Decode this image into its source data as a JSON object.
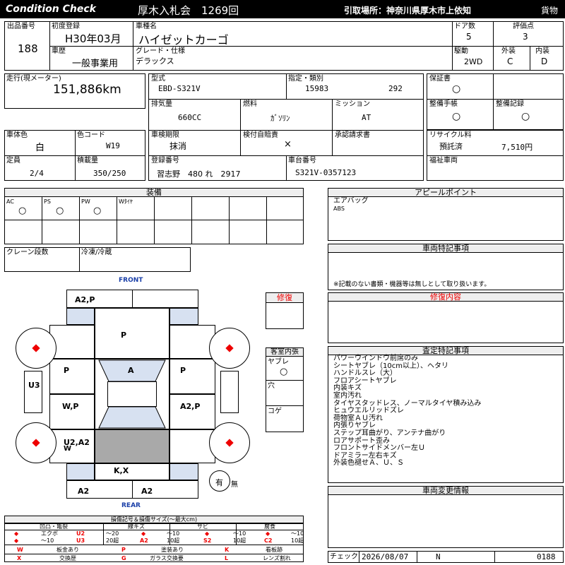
{
  "header": {
    "brand": "Condition Check",
    "auction": "厚木入札会　1269回",
    "pickup": "引取場所：神奈川県厚木市上依知",
    "category": "貨物"
  },
  "vehicle": {
    "lot_label": "出品番号",
    "lot": "188",
    "reg_label": "初度登録",
    "reg": "H30年03月",
    "name_label": "車種名",
    "name": "ハイゼットカーゴ",
    "doors_label": "ドア数",
    "doors": "5",
    "score_label": "評価点",
    "score": "3",
    "history_label": "車歴",
    "history": "一般事業用",
    "grade_label": "グレード・仕様",
    "grade": "デラックス",
    "drive_label": "駆動",
    "drive": "2WD",
    "ext_label": "外装",
    "ext": "C",
    "int_label": "内装",
    "int": "D"
  },
  "specs": {
    "mileage_label": "走行(現メーター)",
    "mileage": "151,886km",
    "model_label": "型式",
    "model": "EBD-S321V",
    "designation_label": "指定・類別",
    "designation": "15983",
    "category_no": "292",
    "warranty_label": "保証書",
    "warranty": "○",
    "displacement_label": "排気量",
    "displacement": "660CC",
    "fuel_label": "燃料",
    "fuel": "ｶﾞｿﾘﾝ",
    "mission_label": "ミッション",
    "mission": "AT",
    "maint_manual_label": "整備手帳",
    "maint_manual": "○",
    "maint_record_label": "整備記録",
    "maint_record": "○",
    "body_color_label": "車体色",
    "body_color": "白",
    "color_code_label": "色コード",
    "color_code": "W19",
    "inspection_label": "車検期限",
    "inspection": "抹消",
    "insurance_label": "検付自賠責",
    "insurance": "×",
    "approval_label": "承認請求書",
    "approval": "",
    "recycle_label": "リサイクル料",
    "recycle_status": "預託済",
    "recycle_fee": "7,510円",
    "capacity_label": "定員",
    "capacity": "2/4",
    "payload_label": "積載量",
    "payload": "350/250",
    "plate_label": "登録番号",
    "plate": "習志野　480 れ　2917",
    "chassis_label": "車台番号",
    "chassis": "S321V-0357123",
    "welfare_label": "福祉車両"
  },
  "equipment": {
    "title": "装備",
    "items": [
      {
        "label": "AC",
        "mark": "○"
      },
      {
        "label": "PS",
        "mark": "○"
      },
      {
        "label": "PW",
        "mark": "○"
      },
      {
        "label": "Wﾀｲﾔ",
        "mark": ""
      }
    ],
    "crane_label": "クレーン段数",
    "freezer_label": "冷凍/冷蔵"
  },
  "appeal": {
    "title": "アピールポイント",
    "lines": [
      "エアバッグ",
      "ABS"
    ]
  },
  "special": {
    "title": "車両特記事項",
    "note": "※記載のない書類・機器等は無しとして取り扱います。"
  },
  "repair": {
    "label": "修復"
  },
  "repair_content": {
    "title": "修復内容"
  },
  "interior": {
    "title": "客室内張",
    "tear_label": "ヤブレ",
    "tear_mark": "○",
    "hole_label": "穴",
    "burn_label": "コゲ"
  },
  "inspection_notes": {
    "title": "査定特記事項",
    "lines": [
      "パワーウインドウ前席のみ",
      "シートヤブレ（10cm以上）、ヘタリ",
      "ハンドルスレ（大）",
      "フロアシートヤブレ",
      "内装キズ",
      "室内汚れ",
      "タイヤスタッドレス、ノーマルタイヤ積み込み",
      "ヒュウエルリッドズレ",
      "荷物室ＡＵ汚れ",
      "内張りヤブレ",
      "ステップ耳曲がり、アンテナ曲がり",
      "ロアサポート歪み",
      "フロントサイドメンバー左Ｕ",
      "ドアミラー左右キズ",
      "外装色褪せＡ、Ｕ、Ｓ"
    ]
  },
  "change_info": {
    "title": "車両変更情報"
  },
  "diagram": {
    "front": "FRONT",
    "rear": "REAR",
    "panels": {
      "hood": "A2,P",
      "roof": "P",
      "left_front_door": "P",
      "windshield": "A",
      "right_front_door": "P",
      "left_side": "U3",
      "left_rear_door": "W,P",
      "right_rear_door": "A2,P",
      "left_quarter": "U2,A2",
      "left_quarter_sub": "W",
      "rear_gate": "K,X",
      "rear_bumper_left": "A2",
      "rear_bumper_right": "A2"
    },
    "spare": "有",
    "spare_none": "無"
  },
  "legend": {
    "title": "損傷記号＆損傷サイズ(〜最大cm)",
    "groups": [
      "凹凸・亀裂",
      "線キズ",
      "サビ",
      "腐食"
    ],
    "row1": [
      "◆",
      "エクボ",
      "U2",
      "〜20",
      "◆",
      "〜10",
      "◆",
      "〜10",
      "◆",
      "〜10"
    ],
    "row2": [
      "◆",
      "〜10",
      "U3",
      "20超",
      "A2",
      "10超",
      "S2",
      "10超",
      "C2",
      "10超"
    ],
    "extra": [
      {
        "code": "W",
        "text": "板金あり"
      },
      {
        "code": "P",
        "text": "塗装あり"
      },
      {
        "code": "K",
        "text": "交換歴"
      },
      {
        "code": "X",
        "text": "交換歴"
      },
      {
        "code": "G",
        "text": "ガラス交換要"
      },
      {
        "code": "L",
        "text": "レンズ割れ"
      }
    ],
    "extra_labels": [
      "板金あり",
      "塗装あり",
      "看板跡",
      "交換歴",
      "ガラス交換要",
      "レンズ割れ"
    ]
  },
  "footer": {
    "check_label": "チェック",
    "date": "2026/08/07",
    "code": "N",
    "number": "0188"
  },
  "colors": {
    "header_bg": "#000000",
    "accent_red": "#e00000",
    "shade_blue": "#d7e1f1"
  }
}
